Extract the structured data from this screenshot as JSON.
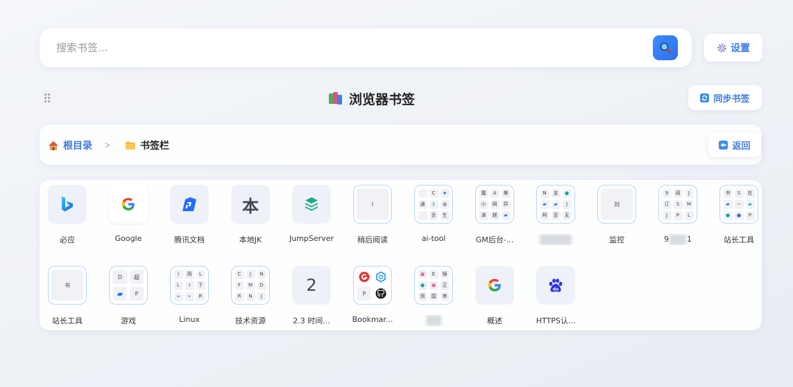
{
  "search": {
    "placeholder": "搜索书签..."
  },
  "header": {
    "settings_label": "设置",
    "title": "浏览器书签",
    "sync_label": "同步书签"
  },
  "breadcrumb": {
    "root_label": "根目录",
    "separator": ">",
    "current_label": "书签栏",
    "back_label": "返回"
  },
  "bookmarks": [
    {
      "label": "必应",
      "icon": "bing-icon"
    },
    {
      "label": "Google",
      "icon": "google-icon"
    },
    {
      "label": "腾讯文档",
      "icon": "tencent-docs-icon"
    },
    {
      "label": "本地JK",
      "icon_text": "本"
    },
    {
      "label": "JumpServer",
      "icon": "jumpserver-icon"
    },
    {
      "label": "稍后阅读",
      "cell": "I"
    },
    {
      "label": "ai-tool",
      "cells": [
        "",
        "C",
        "★",
        "通",
        "§",
        "◎",
        "",
        "豆",
        "生"
      ]
    },
    {
      "label": "GM后台-...",
      "cells": [
        "魔",
        "A",
        "美",
        "小",
        "网",
        "异",
        "演",
        "越",
        ""
      ]
    },
    {
      "label": "",
      "cells": [
        "N",
        "支",
        "",
        "",
        "",
        "J",
        "阿",
        "亚",
        "无"
      ]
    },
    {
      "label": "监控",
      "cell": "刘"
    },
    {
      "label": "9",
      "label_end": "1",
      "cells": [
        "9",
        "阅",
        "J",
        "订",
        "S",
        "M",
        "J",
        "P",
        "L"
      ]
    },
    {
      "label": "站长工具",
      "cells": [
        "书",
        "S",
        "在",
        "",
        "",
        "",
        "",
        "",
        "P"
      ]
    },
    {
      "label": "站长工具",
      "cell": "书"
    },
    {
      "label": "游戏",
      "cells2": [
        "D",
        "超",
        "",
        "P"
      ]
    },
    {
      "label": "Linux",
      "cells": [
        "I",
        "用",
        "L",
        "L",
        "I",
        "下",
        "",
        "",
        "R"
      ]
    },
    {
      "label": "技术资源",
      "cells": [
        "C",
        "J",
        "N",
        "F",
        "M",
        "D",
        "R",
        "N",
        "J"
      ]
    },
    {
      "label": "2.3   时间...",
      "icon_text": "2"
    },
    {
      "label": "Bookmar...",
      "cells2": [
        "",
        "",
        "P",
        ""
      ]
    },
    {
      "label": "",
      "cells": [
        "",
        "E",
        "镜",
        "",
        "",
        "正",
        "测",
        "国",
        "审"
      ]
    },
    {
      "label": "概述",
      "icon": "google-icon"
    },
    {
      "label": "HTTPS认...",
      "icon": "baidu-icon"
    }
  ],
  "colors": {
    "accent": "#3d7ae0",
    "search_button": "#2f6fe8"
  }
}
